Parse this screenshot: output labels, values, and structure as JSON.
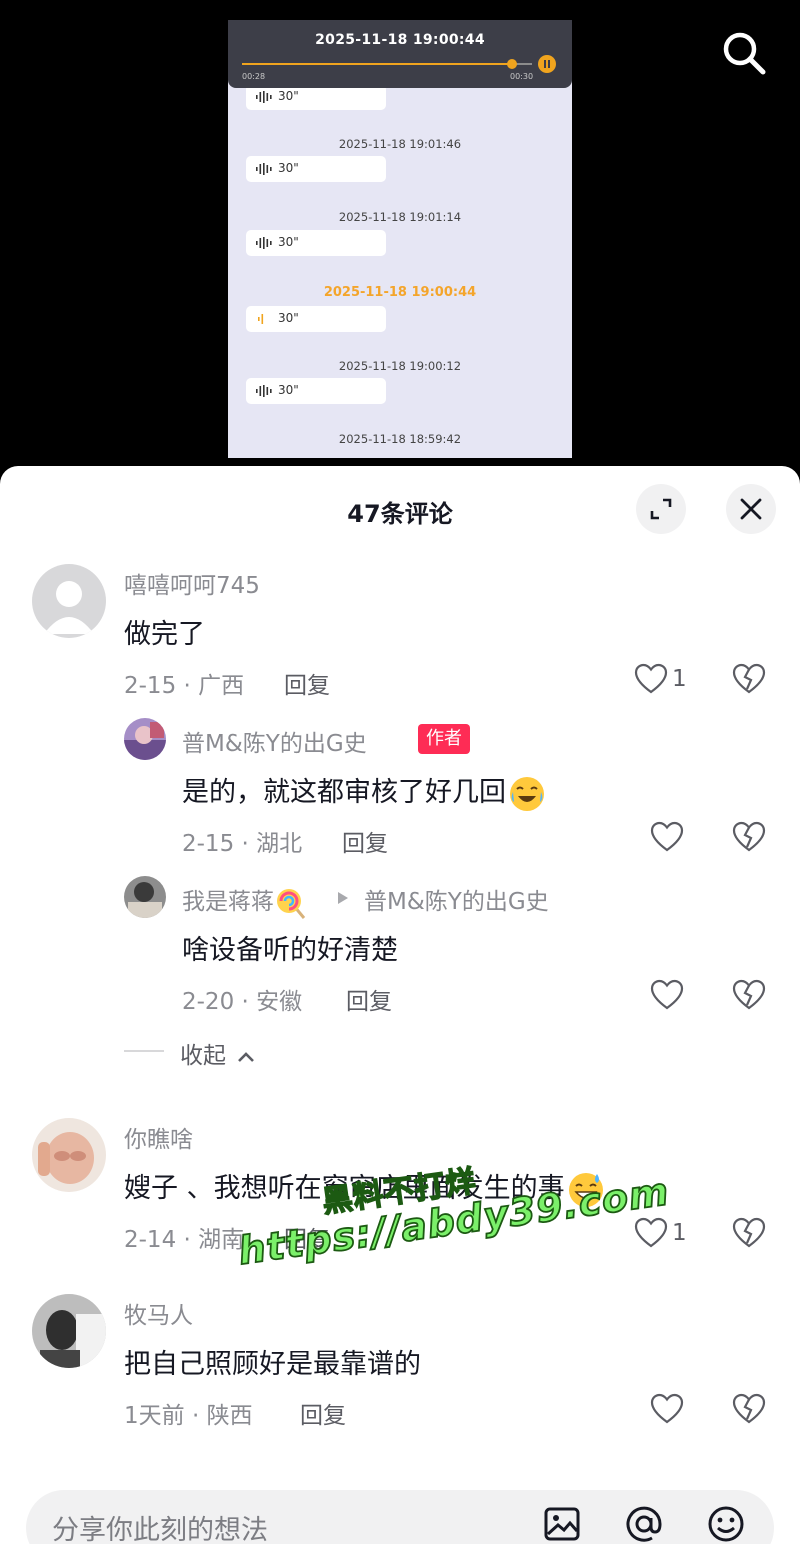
{
  "video": {
    "player": {
      "title_time": "2025-11-18 19:00:44",
      "current_time": "00:28",
      "duration": "00:30",
      "progress": 0.93
    },
    "records": [
      {
        "time": "",
        "duration": "30\"",
        "active": false
      },
      {
        "time": "2025-11-18 19:01:46",
        "duration": "30\"",
        "active": false
      },
      {
        "time": "2025-11-18 19:01:14",
        "duration": "30\"",
        "active": false
      },
      {
        "time": "2025-11-18 19:00:44",
        "duration": "30\"",
        "active": true
      },
      {
        "time": "2025-11-18 19:00:12",
        "duration": "30\"",
        "active": false
      },
      {
        "time": "2025-11-18 18:59:42",
        "duration": "",
        "active": false
      }
    ]
  },
  "sheet": {
    "title": "47条评论"
  },
  "comments": {
    "c1": {
      "username": "嘻嘻呵呵745",
      "text": "做完了",
      "meta": "2-15 · 广西",
      "reply": "回复",
      "likes": "1"
    },
    "r1": {
      "username": "普M&陈Y的出G史",
      "badge": "作者",
      "text": "是的，就这都审核了好几回",
      "meta": "2-15 · 湖北",
      "reply": "回复"
    },
    "r2": {
      "username": "我是蒋蒋",
      "reply_to": "普M&陈Y的出G史",
      "text": "啥设备听的好清楚",
      "meta": "2-20 · 安徽",
      "reply": "回复"
    },
    "collapse": "收起",
    "c2": {
      "username": "你瞧啥",
      "text": "嫂子 、我想听在窗帘店里面发生的事",
      "meta": "2-14 · 湖南",
      "reply": "回复",
      "likes": "1"
    },
    "c3": {
      "username": "牧马人",
      "text": "把自己照顾好是最靠谱的",
      "meta": "1天前 · 陕西",
      "reply": "回复"
    }
  },
  "watermark": {
    "line1": "黑料不打烊",
    "line2": "https://abdy39.com"
  },
  "input": {
    "placeholder": "分享你此刻的想法"
  },
  "colors": {
    "accent": "#fe2c55",
    "player_orange": "#f0a41e",
    "watermark_green": "#7bf06a"
  },
  "icons": [
    "search-icon",
    "expand-icon",
    "close-icon",
    "heart-icon",
    "broken-heart-icon",
    "image-icon",
    "at-icon",
    "emoji-icon",
    "lollipop-icon",
    "play-triangle-icon"
  ]
}
